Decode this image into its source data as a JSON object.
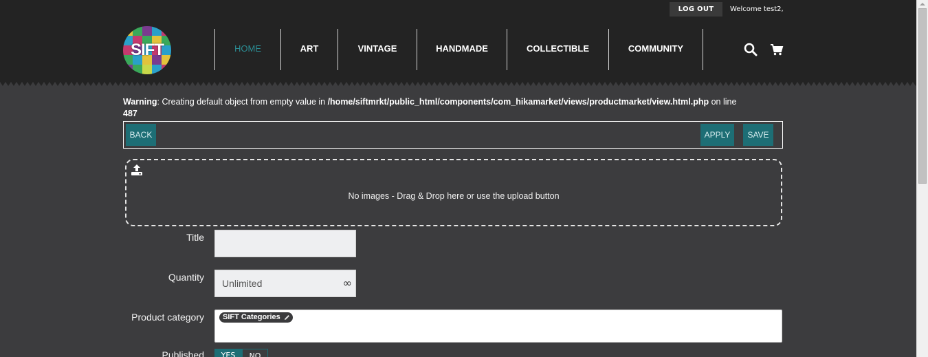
{
  "topbar": {
    "logout_label": "LOG OUT",
    "welcome_text": "Welcome test2,"
  },
  "logo": {
    "text": "SIFT"
  },
  "nav": {
    "items": [
      {
        "label": "HOME",
        "active": true
      },
      {
        "label": "ART"
      },
      {
        "label": "VINTAGE"
      },
      {
        "label": "HANDMADE"
      },
      {
        "label": "COLLECTIBLE"
      },
      {
        "label": "COMMUNITY"
      }
    ]
  },
  "icons": {
    "search": "search-icon",
    "cart": "cart-icon",
    "upload": "upload-icon",
    "pencil": "pencil-icon",
    "infinity": "infinity-icon"
  },
  "warning": {
    "label": "Warning",
    "message": ": Creating default object from empty value in ",
    "path": "/home/siftmrkt/public_html/components/com_hikamarket/views/productmarket/view.html.php",
    "on_line": " on line ",
    "line": "487"
  },
  "toolbar": {
    "back_label": "BACK",
    "apply_label": "APPLY",
    "save_label": "SAVE"
  },
  "dropzone": {
    "text": "No images - Drag & Drop here or use the upload button"
  },
  "form": {
    "title_label": "Title",
    "title_value": "",
    "quantity_label": "Quantity",
    "quantity_value": "Unlimited",
    "quantity_symbol": "∞",
    "category_label": "Product category",
    "category_tag": "SIFT Categories",
    "published_label": "Published",
    "published_yes": "YES",
    "published_no": "NO"
  },
  "colors": {
    "header_bg": "#232323",
    "page_bg": "#3c3c3e",
    "accent": "#1d6e75",
    "nav_active": "#2b8c93"
  }
}
